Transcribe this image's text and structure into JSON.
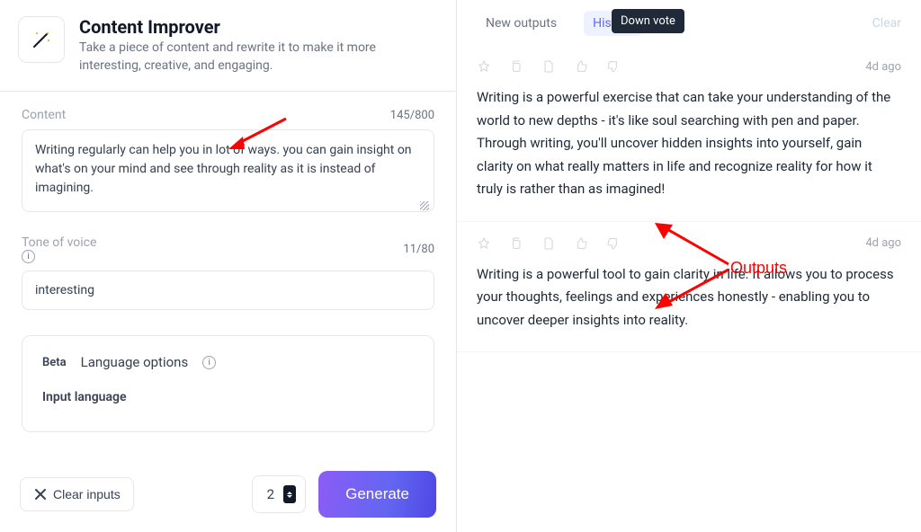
{
  "header": {
    "title": "Content Improver",
    "subtitle": "Take a piece of content and rewrite it to make it more interesting, creative, and engaging."
  },
  "content": {
    "label": "Content",
    "counter": "145/800",
    "value": "Writing regularly can help you in lot of ways. you can gain insight on what's on your mind and see through reality as it is instead of imagining."
  },
  "tone": {
    "label": "Tone of voice",
    "counter": "11/80",
    "value": "interesting"
  },
  "lang": {
    "beta": "Beta",
    "title": "Language options",
    "input_lang_label": "Input language"
  },
  "footer": {
    "clear": "Clear inputs",
    "qty": "2",
    "generate": "Generate"
  },
  "tabs": {
    "new": "New outputs",
    "history": "History",
    "clear": "Clear",
    "tooltip": "Down vote"
  },
  "outputs_label": "Outputs",
  "cards": [
    {
      "ago": "4d ago",
      "text": "Writing is a powerful exercise that can take your understanding of the world to new depths - it's like soul searching with pen and paper. Through writing, you'll uncover hidden insights into yourself, gain clarity on what really matters in life and recognize reality for how it truly is rather than as imagined!"
    },
    {
      "ago": "4d ago",
      "text": "Writing is a powerful tool to gain clarity in life. It allows you to process your thoughts, feelings and experiences honestly - enabling you to uncover deeper insights into reality."
    }
  ]
}
